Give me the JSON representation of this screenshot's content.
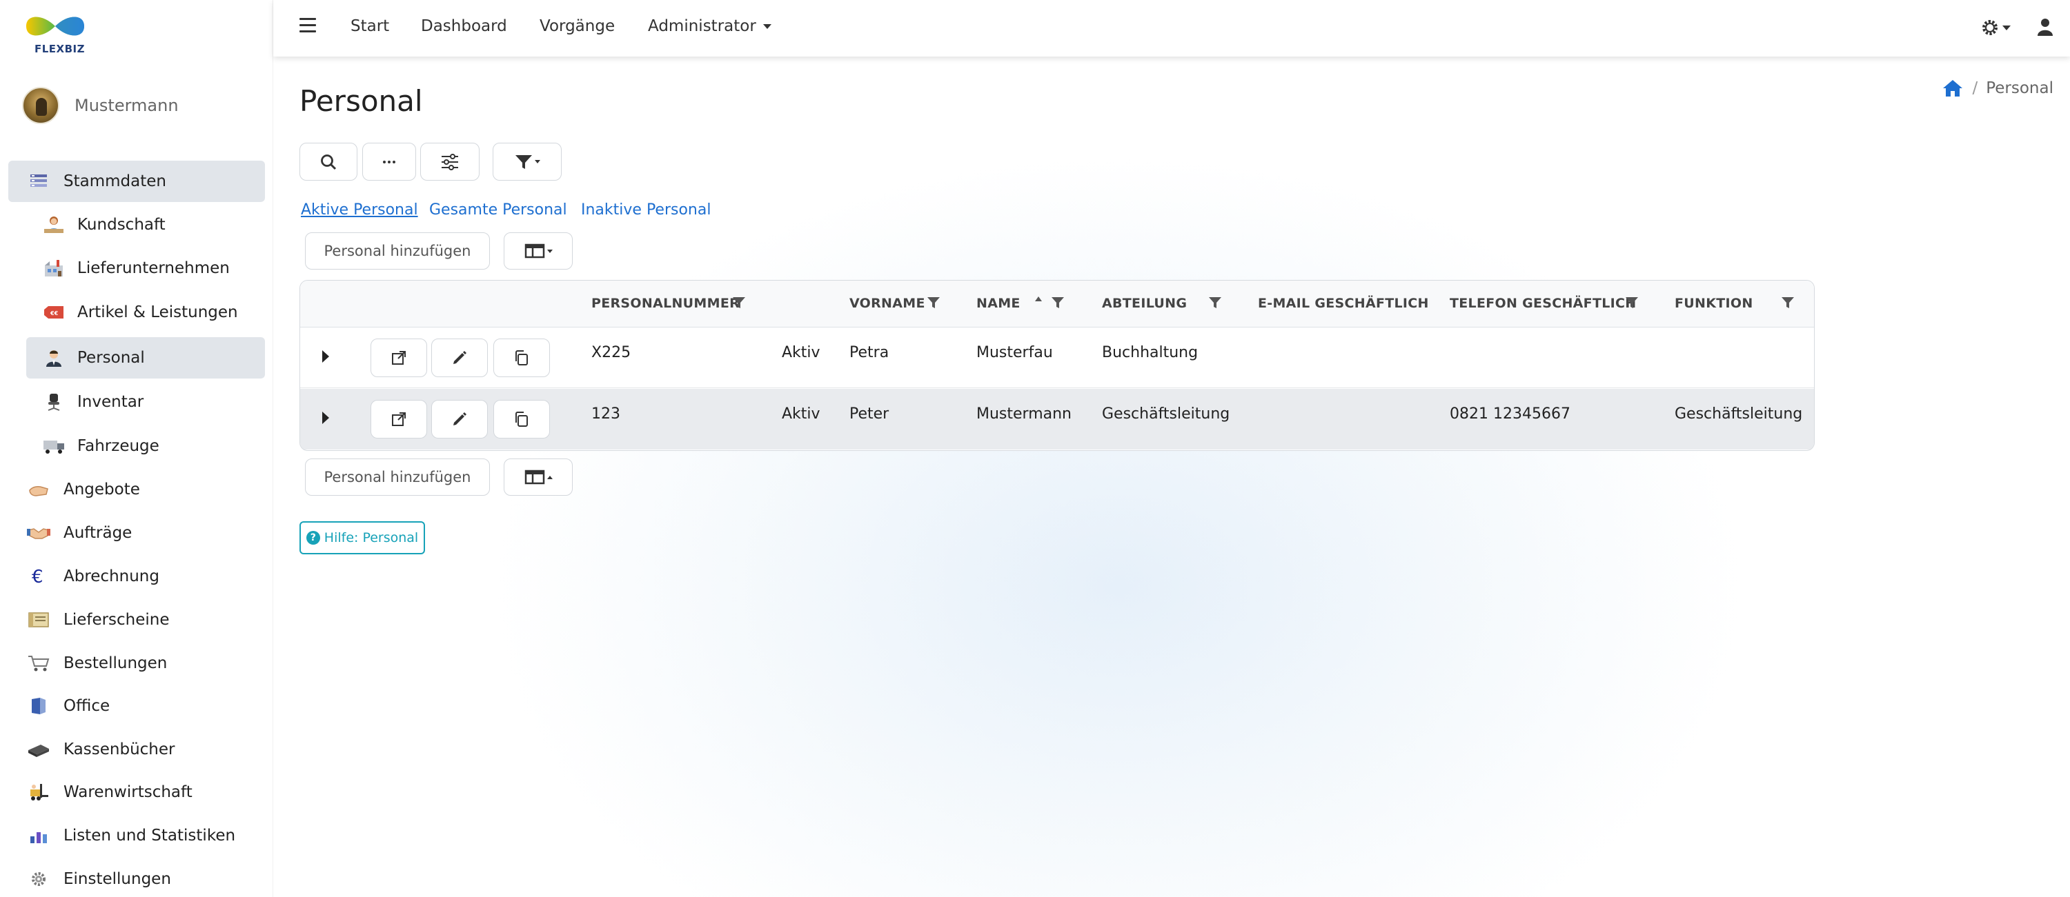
{
  "app": {
    "logo_text": "FLEXBIZ",
    "user_name": "Mustermann"
  },
  "sidebar": {
    "items": [
      {
        "label": "Stammdaten",
        "icon": "stack-icon"
      },
      {
        "label": "Kundschaft",
        "icon": "customer-icon"
      },
      {
        "label": "Lieferunternehmen",
        "icon": "factory-icon"
      },
      {
        "label": "Artikel & Leistungen",
        "icon": "price-tag-icon"
      },
      {
        "label": "Personal",
        "icon": "person-icon"
      },
      {
        "label": "Inventar",
        "icon": "office-chair-icon"
      },
      {
        "label": "Fahrzeuge",
        "icon": "truck-icon"
      },
      {
        "label": "Angebote",
        "icon": "hand-icon"
      },
      {
        "label": "Aufträge",
        "icon": "handshake-icon"
      },
      {
        "label": "Abrechnung",
        "icon": "euro-icon"
      },
      {
        "label": "Lieferscheine",
        "icon": "delivery-note-icon"
      },
      {
        "label": "Bestellungen",
        "icon": "cart-icon"
      },
      {
        "label": "Office",
        "icon": "office-icon"
      },
      {
        "label": "Kassenbücher",
        "icon": "cashbook-icon"
      },
      {
        "label": "Warenwirtschaft",
        "icon": "forklift-icon"
      },
      {
        "label": "Listen und Statistiken",
        "icon": "chart-icon"
      },
      {
        "label": "Einstellungen",
        "icon": "gear-icon"
      }
    ]
  },
  "topbar": {
    "nav": [
      "Start",
      "Dashboard",
      "Vorgänge",
      "Administrator"
    ]
  },
  "page": {
    "title": "Personal",
    "breadcrumb": {
      "current": "Personal"
    },
    "filters": [
      "Aktive Personal",
      "Gesamte Personal",
      "Inaktive Personal"
    ],
    "add_button": "Personal hinzufügen",
    "help": "Hilfe: Personal"
  },
  "table": {
    "columns": [
      "PERSONALNUMMER",
      "VORNAME",
      "NAME",
      "ABTEILUNG",
      "E-MAIL GESCHÄFTLICH",
      "TELEFON GESCHÄFTLICH",
      "FUNKTION"
    ],
    "rows": [
      {
        "personalnummer": "X225",
        "status": "Aktiv",
        "vorname": "Petra",
        "name": "Musterfau",
        "abteilung": "Buchhaltung",
        "email": "",
        "telefon": "",
        "funktion": ""
      },
      {
        "personalnummer": "123",
        "status": "Aktiv",
        "vorname": "Peter",
        "name": "Mustermann",
        "abteilung": "Geschäftsleitung",
        "email": "",
        "telefon": "0821 12345667",
        "funktion": "Geschäftsleitung"
      }
    ]
  },
  "colors": {
    "accent": "#1e6fd0",
    "help": "#17a2b8",
    "active_bg": "#e1e5ea"
  }
}
